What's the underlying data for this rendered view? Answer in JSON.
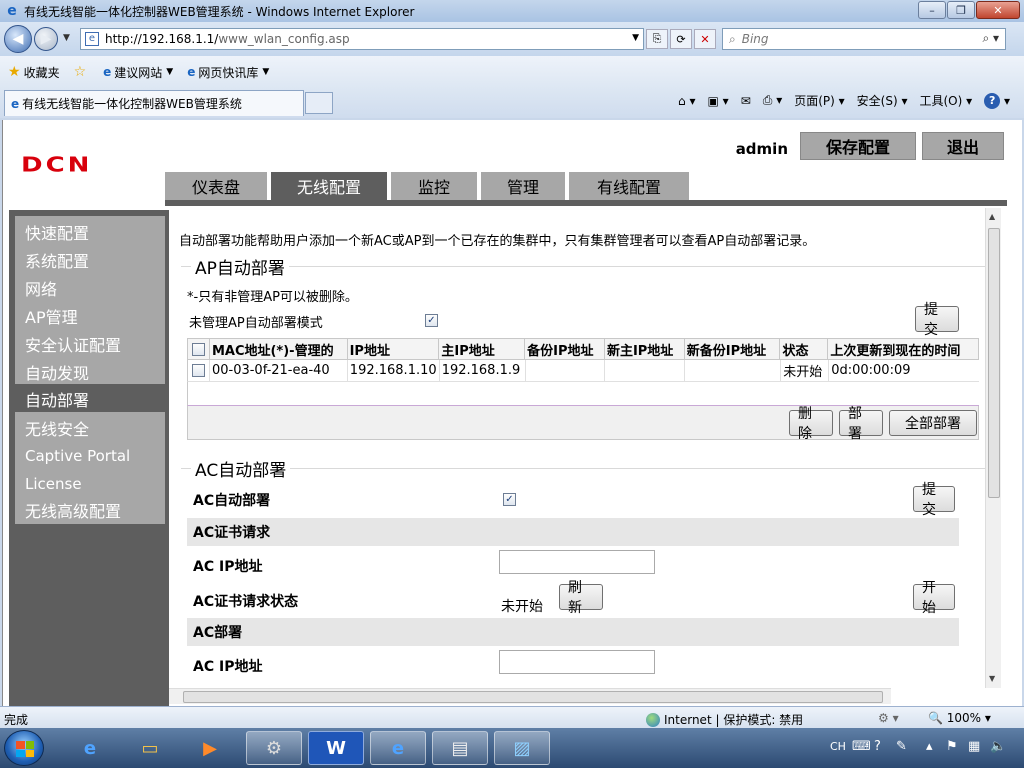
{
  "window": {
    "title": "有线无线智能一体化控制器WEB管理系统 - Windows Internet Explorer",
    "minimize_label": "–",
    "restore_label": "❐",
    "close_label": "✕"
  },
  "address_bar": {
    "url_host": "http://192.168.1.1/",
    "url_path": "www_wlan_config.asp",
    "search_placeholder": "Bing"
  },
  "favorites_bar": {
    "favorites_label": "收藏夹",
    "suggested_sites": "建议网站",
    "web_slices": "网页快讯库"
  },
  "tab": {
    "title": "有线无线智能一体化控制器WEB管理系统"
  },
  "command_bar": {
    "page": "页面(P)",
    "safety": "安全(S)",
    "tools": "工具(O)"
  },
  "header": {
    "logo": "DCN",
    "user": "admin",
    "save_config": "保存配置",
    "logout": "退出"
  },
  "main_tabs": [
    {
      "label": "仪表盘",
      "active": false
    },
    {
      "label": "无线配置",
      "active": true
    },
    {
      "label": "监控",
      "active": false
    },
    {
      "label": "管理",
      "active": false
    },
    {
      "label": "有线配置",
      "active": false
    }
  ],
  "sidebar": {
    "items": [
      {
        "label": "快速配置"
      },
      {
        "label": "系统配置"
      },
      {
        "label": "网络"
      },
      {
        "label": "AP管理"
      },
      {
        "label": "安全认证配置"
      },
      {
        "label": "自动发现"
      },
      {
        "label": "自动部署",
        "active": true
      },
      {
        "label": "无线安全"
      },
      {
        "label": "Captive Portal"
      },
      {
        "label": "License"
      },
      {
        "label": "无线高级配置"
      }
    ]
  },
  "content": {
    "intro": "自动部署功能帮助用户添加一个新AC或AP到一个已存在的集群中，只有集群管理者可以查看AP自动部署记录。",
    "ap_section": {
      "legend": "AP自动部署",
      "note": "*-只有非管理AP可以被删除。",
      "mode_label": "未管理AP自动部署模式",
      "mode_checked": true,
      "submit": "提交",
      "columns": [
        "MAC地址(*)-管理的",
        "IP地址",
        "主IP地址",
        "备份IP地址",
        "新主IP地址",
        "新备份IP地址",
        "状态",
        "上次更新到现在的时间"
      ],
      "rows": [
        [
          "00-03-0f-21-ea-40",
          "192.168.1.10",
          "192.168.1.9",
          "",
          "",
          "",
          "未开始",
          "0d:00:00:09"
        ]
      ],
      "delete": "删除",
      "deploy": "部署",
      "deploy_all": "全部部署"
    },
    "ac_section": {
      "legend": "AC自动部署",
      "ac_deploy_label": "AC自动部署",
      "ac_deploy_checked": true,
      "submit": "提交",
      "cert_band": "AC证书请求",
      "cert_ip_label": "AC IP地址",
      "cert_status_label": "AC证书请求状态",
      "cert_status_value": "未开始",
      "refresh": "刷新",
      "start": "开始",
      "deploy_band": "AC部署",
      "deploy_ip_label": "AC IP地址"
    }
  },
  "status_bar": {
    "status": "完成",
    "zone": "Internet | 保护模式: 禁用",
    "zoom": "100%"
  },
  "taskbar": {
    "ime": "CH"
  }
}
